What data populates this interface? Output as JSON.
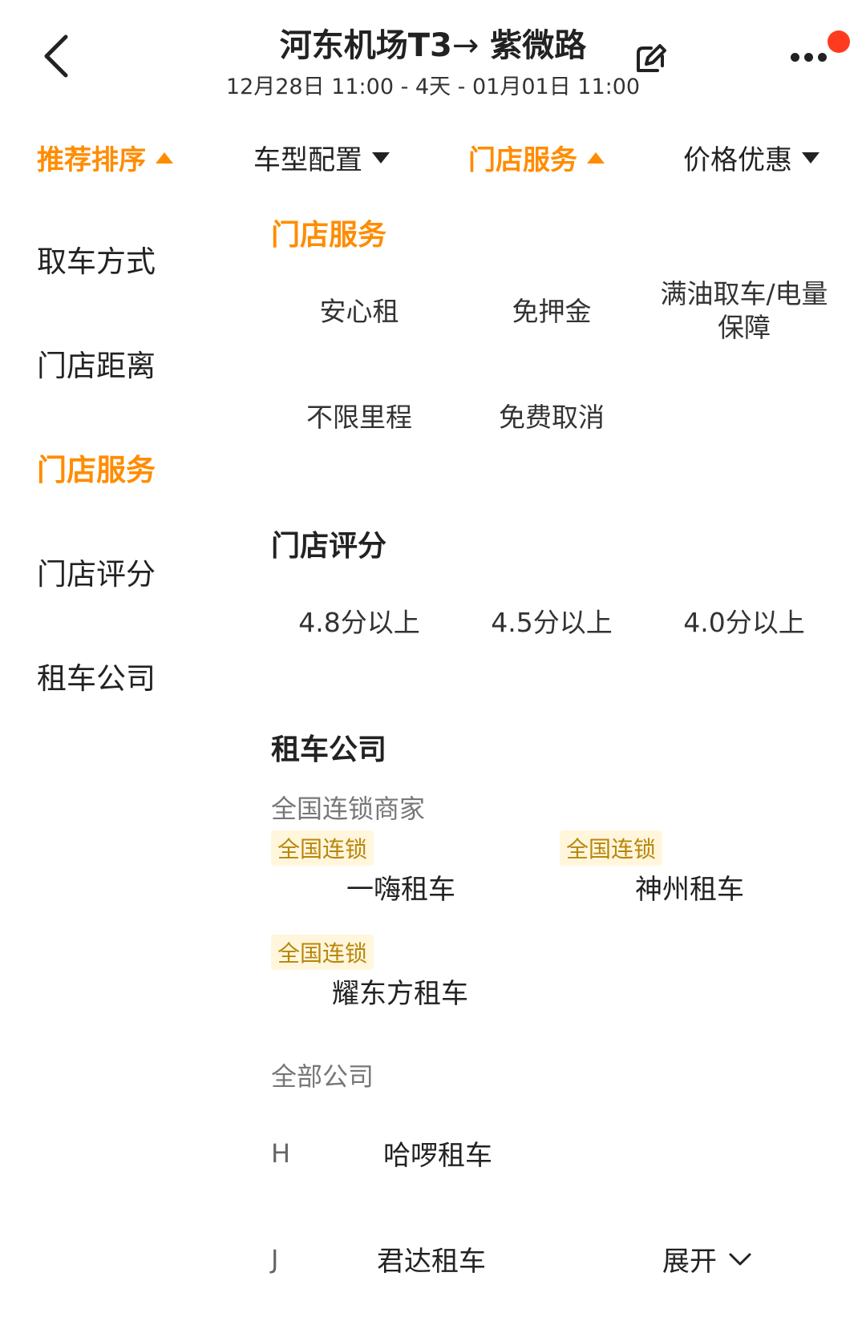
{
  "header": {
    "title_from": "河东机场T3",
    "title_arrow": "→",
    "title_to": "紫微路",
    "subtitle": "12月28日 11:00 - 4天 - 01月01日 11:00"
  },
  "tabs": [
    {
      "label": "推荐排序",
      "arrow": "up"
    },
    {
      "label": "车型配置",
      "arrow": "down"
    },
    {
      "label": "门店服务",
      "arrow": "up"
    },
    {
      "label": "价格优惠",
      "arrow": "down"
    }
  ],
  "menu": [
    "取车方式",
    "门店距离",
    "门店服务",
    "门店评分",
    "租车公司"
  ],
  "store_service": {
    "title": "门店服务",
    "options": [
      "安心租",
      "免押金",
      "满油取车/电量保障",
      "不限里程",
      "免费取消"
    ]
  },
  "store_rating": {
    "title": "门店评分",
    "options": [
      "4.8分以上",
      "4.5分以上",
      "4.0分以上"
    ]
  },
  "rental_company": {
    "title": "租车公司",
    "chain_head": "全国连锁商家",
    "chains": [
      {
        "badge": "全国连锁",
        "name": "一嗨租车"
      },
      {
        "badge": "全国连锁",
        "name": "神州租车"
      },
      {
        "badge": "全国连锁",
        "name": "耀东方租车"
      }
    ],
    "all_head": "全部公司",
    "groups": [
      {
        "letter": "H",
        "name": "哈啰租车"
      },
      {
        "letter": "J",
        "name": "君达租车"
      }
    ],
    "expand_label": "展开"
  },
  "colors": {
    "accent": "#ff8c00",
    "badge_text": "#b8860b",
    "badge_bg": "#fff6dc",
    "red_dot": "#ff3b1f"
  }
}
